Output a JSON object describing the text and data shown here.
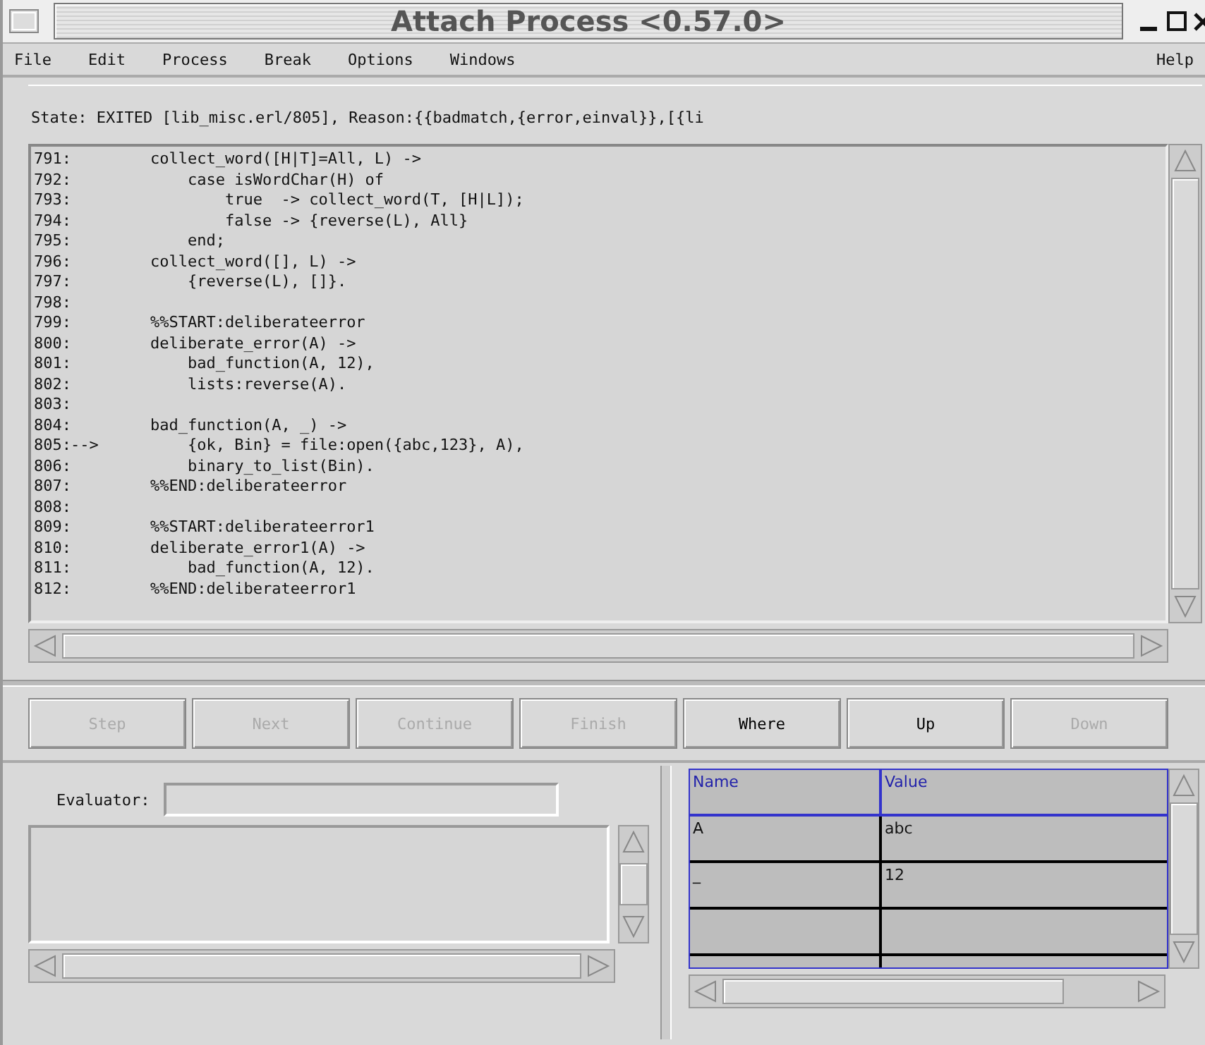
{
  "window": {
    "title": "Attach Process <0.57.0>"
  },
  "menu": {
    "left": [
      "File",
      "Edit",
      "Process",
      "Break",
      "Options",
      "Windows"
    ],
    "right": "Help"
  },
  "state_line": "State: EXITED [lib_misc.erl/805], Reason:{{badmatch,{error,einval}},[{li",
  "code": [
    {
      "number": "791:",
      "code": "    collect_word([H|T]=All, L) ->"
    },
    {
      "number": "792:",
      "code": "        case isWordChar(H) of"
    },
    {
      "number": "793:",
      "code": "            true  -> collect_word(T, [H|L]);"
    },
    {
      "number": "794:",
      "code": "            false -> {reverse(L), All}"
    },
    {
      "number": "795:",
      "code": "        end;"
    },
    {
      "number": "796:",
      "code": "    collect_word([], L) ->"
    },
    {
      "number": "797:",
      "code": "        {reverse(L), []}."
    },
    {
      "number": "798:"
    },
    {
      "number": "799:",
      "code": "    %%START:deliberateerror"
    },
    {
      "number": "800:",
      "code": "    deliberate_error(A) ->"
    },
    {
      "number": "801:",
      "code": "        bad_function(A, 12),"
    },
    {
      "number": "802:",
      "code": "        lists:reverse(A)."
    },
    {
      "number": "803:"
    },
    {
      "number": "804:",
      "code": "    bad_function(A, _) ->"
    },
    {
      "number": "805:",
      "marker": "-->",
      "code": "        {ok, Bin} = file:open({abc,123}, A),"
    },
    {
      "number": "806:",
      "code": "        binary_to_list(Bin)."
    },
    {
      "number": "807:",
      "code": "    %%END:deliberateerror"
    },
    {
      "number": "808:"
    },
    {
      "number": "809:",
      "code": "    %%START:deliberateerror1"
    },
    {
      "number": "810:",
      "code": "    deliberate_error1(A) ->"
    },
    {
      "number": "811:",
      "code": "        bad_function(A, 12)."
    },
    {
      "number": "812:",
      "code": "    %%END:deliberateerror1"
    }
  ],
  "buttons": [
    {
      "label": "Step",
      "disabled": true
    },
    {
      "label": "Next",
      "disabled": true
    },
    {
      "label": "Continue",
      "disabled": true
    },
    {
      "label": "Finish",
      "disabled": true
    },
    {
      "label": "Where",
      "disabled": false
    },
    {
      "label": "Up",
      "disabled": false
    },
    {
      "label": "Down",
      "disabled": true
    }
  ],
  "evaluator": {
    "label": "Evaluator:"
  },
  "bindings": {
    "columns": [
      "Name",
      "Value"
    ],
    "rows": [
      {
        "name": "A",
        "value": "abc"
      },
      {
        "name": "_",
        "value": "12"
      }
    ]
  }
}
